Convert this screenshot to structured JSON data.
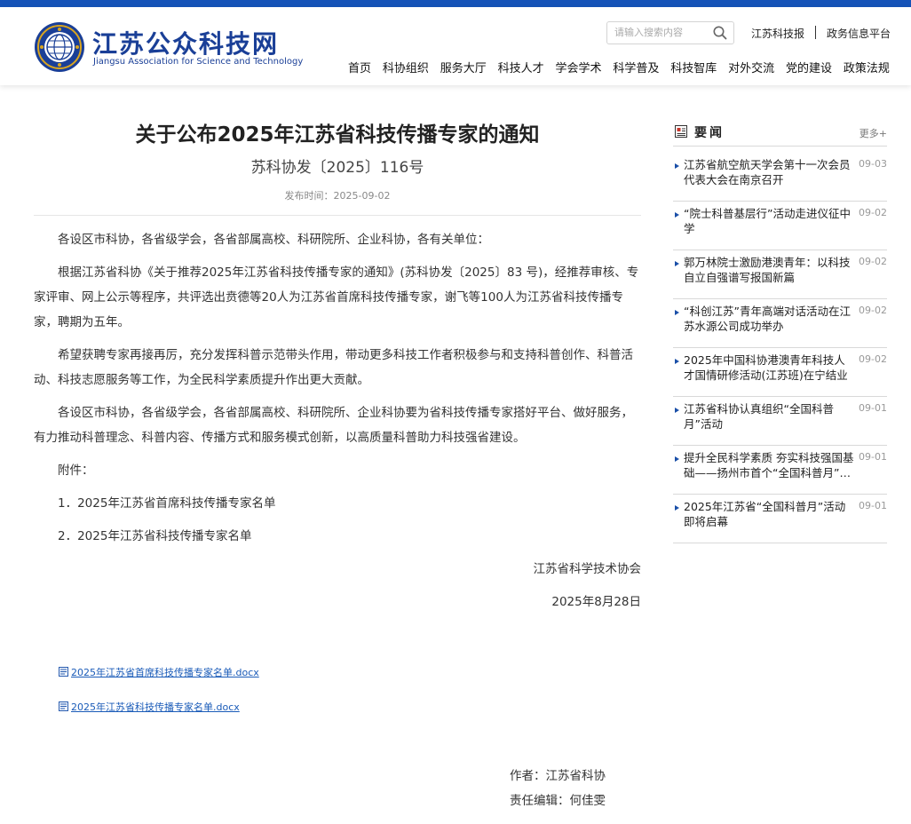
{
  "header": {
    "logo_cn": "江苏公众科技网",
    "logo_en": "Jiangsu Association for Science and Technology",
    "search_placeholder": "请输入搜索内容",
    "top_links": [
      "江苏科技报",
      "政务信息平台"
    ],
    "nav": [
      "首页",
      "科协组织",
      "服务大厅",
      "科技人才",
      "学会学术",
      "科学普及",
      "科技智库",
      "对外交流",
      "党的建设",
      "政策法规"
    ],
    "brand_color": "#1a3f97",
    "topbar_color": "#1553b8"
  },
  "article": {
    "title": "关于公布2025年江苏省科技传播专家的通知",
    "doc_number": "苏科协发〔2025〕116号",
    "published": "发布时间：2025-09-02",
    "paragraphs": [
      "各设区市科协，各省级学会，各省部属高校、科研院所、企业科协，各有关单位：",
      "根据江苏省科协《关于推荐2025年江苏省科技传播专家的通知》(苏科协发〔2025〕83 号)，经推荐审核、专家评审、网上公示等程序，共评选出贲德等20人为江苏省首席科技传播专家，谢飞等100人为江苏省科技传播专家，聘期为五年。",
      "希望获聘专家再接再厉，充分发挥科普示范带头作用，带动更多科技工作者积极参与和支持科普创作、科普活动、科技志愿服务等工作，为全民科学素质提升作出更大贡献。",
      "各设区市科协，各省级学会，各省部属高校、科研院所、企业科协要为省科技传播专家搭好平台、做好服务，有力推动科普理念、科普内容、传播方式和服务模式创新，以高质量科普助力科技强省建设。"
    ],
    "attachment_label": "附件：",
    "attachments": [
      "1．2025年江苏省首席科技传播专家名单",
      "2．2025年江苏省科技传播专家名单"
    ],
    "issuer": "江苏省科学技术协会",
    "issue_date": "2025年8月28日",
    "files": [
      "2025年江苏省首席科技传播专家名单.docx",
      "2025年江苏省科技传播专家名单.docx"
    ],
    "author": "作者：江苏省科协",
    "editor": "责任编辑：何佳雯"
  },
  "sidebar": {
    "title": "要闻",
    "more": "更多+",
    "items": [
      {
        "title": "江苏省航空航天学会第十一次会员代表大会在南京召开",
        "date": "09-03"
      },
      {
        "title": "“院士科普基层行”活动走进仪征中学",
        "date": "09-02"
      },
      {
        "title": "郭万林院士激励港澳青年：以科技自立自强谱写报国新篇",
        "date": "09-02"
      },
      {
        "title": "“科创江苏”青年高端对话活动在江苏水源公司成功举办",
        "date": "09-02"
      },
      {
        "title": "2025年中国科协港澳青年科技人才国情研修活动(江苏班)在宁结业",
        "date": "09-02"
      },
      {
        "title": "江苏省科协认真组织“全国科普月”活动",
        "date": "09-01"
      },
      {
        "title": "提升全民科学素质 夯实科技强国基础——扬州市首个“全国科普月”启动",
        "date": "09-01"
      },
      {
        "title": "2025年江苏省“全国科普月”活动即将启幕",
        "date": "09-01"
      }
    ]
  }
}
